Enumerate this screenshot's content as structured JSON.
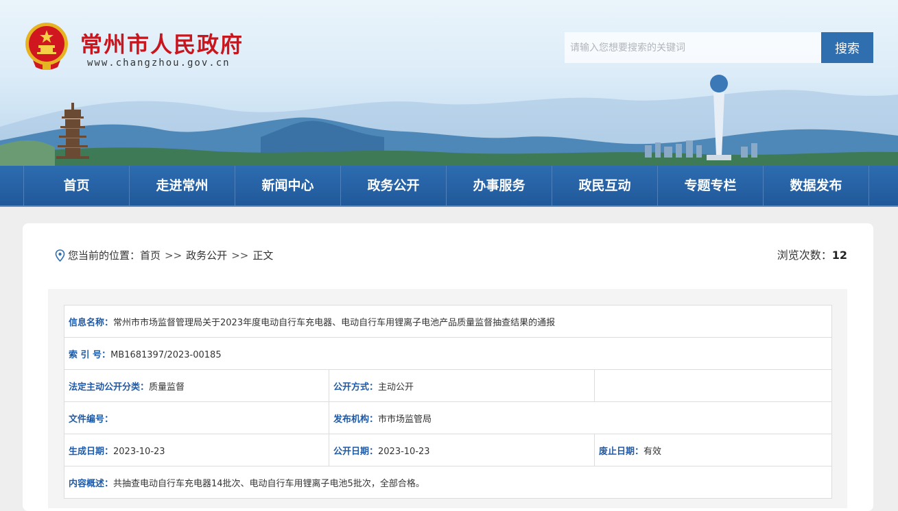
{
  "header": {
    "site_name": "常州市人民政府",
    "site_url": "www.changzhou.gov.cn",
    "search_placeholder": "请输入您想要搜索的关键词",
    "search_button": "搜索"
  },
  "nav": [
    "首页",
    "走进常州",
    "新闻中心",
    "政务公开",
    "办事服务",
    "政民互动",
    "专题专栏",
    "数据发布"
  ],
  "breadcrumb": {
    "prefix": "您当前的位置：",
    "items": [
      "首页",
      "政务公开",
      "正文"
    ],
    "separator": ">>"
  },
  "views": {
    "label": "浏览次数：",
    "count": "12"
  },
  "info": {
    "title_label": "信息名称：",
    "title_value": "常州市市场监督管理局关于2023年度电动自行车充电器、电动自行车用锂离子电池产品质量监督抽查结果的通报",
    "index_label": "索 引 号：",
    "index_value": "MB1681397/2023-00185",
    "category_label": "法定主动公开分类：",
    "category_value": "质量监督",
    "method_label": "公开方式：",
    "method_value": "主动公开",
    "docno_label": "文件编号：",
    "docno_value": "",
    "publisher_label": "发布机构：",
    "publisher_value": "市市场监管局",
    "created_label": "生成日期：",
    "created_value": "2023-10-23",
    "published_label": "公开日期：",
    "published_value": "2023-10-23",
    "expiry_label": "废止日期：",
    "expiry_value": "有效",
    "summary_label": "内容概述：",
    "summary_value": "共抽查电动自行车充电器14批次、电动自行车用锂离子电池5批次，全部合格。"
  },
  "colors": {
    "brand_red": "#c7161d",
    "nav_blue": "#2d6cb0",
    "label_blue": "#1f5aa6"
  }
}
